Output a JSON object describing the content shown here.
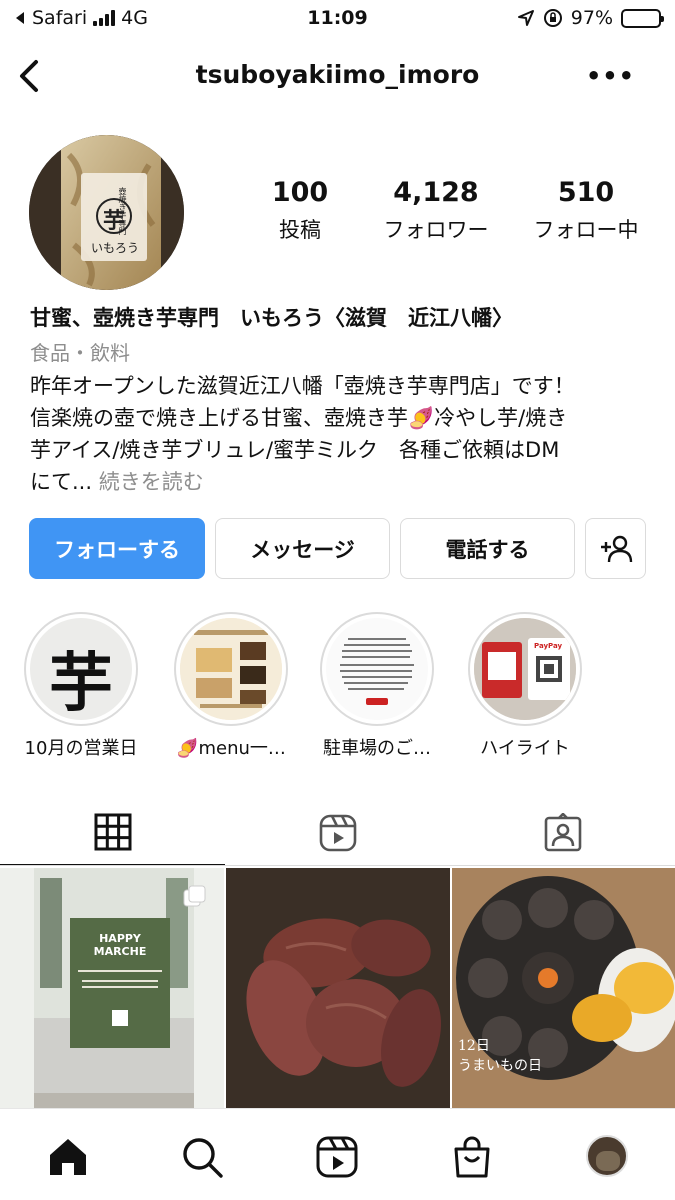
{
  "status_bar": {
    "carrier": "Safari",
    "network": "4G",
    "time": "11:09",
    "battery": "97%",
    "battery_level": 0.97
  },
  "nav": {
    "username": "tsuboyakiimo_imoro",
    "back_icon": "chevron-left-icon",
    "more_icon": "more-horizontal-icon"
  },
  "profile": {
    "avatar_text_top": "壺焼き芋専門",
    "avatar_logo": "芋",
    "avatar_text_bottom": "いもろう",
    "stats": [
      {
        "value": "100",
        "label": "投稿"
      },
      {
        "value": "4,128",
        "label": "フォロワー"
      },
      {
        "value": "510",
        "label": "フォロー中"
      }
    ],
    "display_name": "甘蜜、壺焼き芋専門　いもろう〈滋賀　近江八幡〉",
    "category": "食品・飲料",
    "bio_lines": [
      "昨年オープンした滋賀近江八幡「壺焼き芋専門店」です！",
      "信楽焼の壺で焼き上げる甘蜜、壺焼き芋🍠冷やし芋/焼き",
      "芋アイス/焼き芋ブリュレ/蜜芋ミルク　各種ご依頼はDM",
      "にて..."
    ],
    "read_more": "続きを読む"
  },
  "buttons": {
    "follow": "フォローする",
    "message": "メッセージ",
    "call": "電話する",
    "suggest_icon": "add-person-icon"
  },
  "highlights": [
    {
      "label": "10月の営業日",
      "cover_text": "芋"
    },
    {
      "label": "🍠menu一…"
    },
    {
      "label": "駐車場のご…"
    },
    {
      "label": "ハイライト",
      "cover_text": "PayPay"
    }
  ],
  "tabs": [
    {
      "name": "grid-icon",
      "active": true
    },
    {
      "name": "reels-icon",
      "active": false
    },
    {
      "name": "tagged-icon",
      "active": false
    }
  ],
  "posts": [
    {
      "title": "HAPPY MARCHE",
      "kind": "poster",
      "multi": true
    },
    {
      "kind": "photo-sweet-potatoes"
    },
    {
      "overlay": "12日\nうまいもの日",
      "kind": "photo-pot"
    }
  ],
  "bottom_nav": [
    "home-icon",
    "search-icon",
    "reels-icon",
    "shop-icon",
    "profile-avatar"
  ],
  "colors": {
    "accent": "#4095f4",
    "border": "#dbdbdb",
    "muted": "#8e8e8e"
  }
}
